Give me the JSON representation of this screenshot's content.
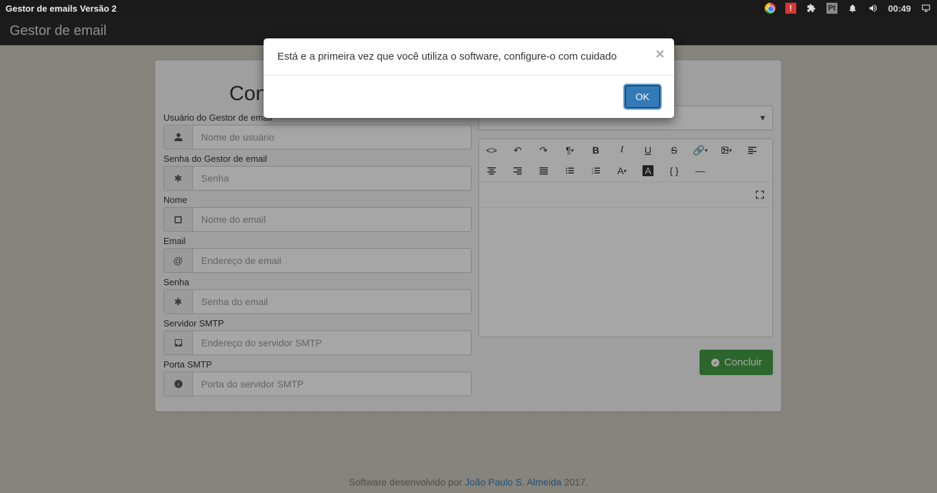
{
  "topbar": {
    "title": "Gestor de emails Versão 2",
    "lang_indicator": "Pt",
    "clock": "00:49"
  },
  "header": {
    "title": "Gestor de email"
  },
  "form": {
    "title": "Conf",
    "user_label": "Usuário do Gestor de email",
    "user_placeholder": "Nome de usuário",
    "pass_label": "Senha do Gestor de email",
    "pass_placeholder": "Senha",
    "name_label": "Nome",
    "name_placeholder": "Nome do email",
    "email_label": "Email",
    "email_placeholder": "Endereço de email",
    "emailpass_label": "Senha",
    "emailpass_placeholder": "Senha do email",
    "smtp_label": "Servidor SMTP",
    "smtp_placeholder": "Endereço do servidor SMTP",
    "port_label": "Porta SMTP",
    "port_placeholder": "Porta do servidor SMTP"
  },
  "editor": {
    "concluir": "Concluir"
  },
  "footer": {
    "pre": "Software desenvolvido por ",
    "link": "João Paulo S. Almeida",
    "post": " 2017."
  },
  "modal": {
    "message": "Está e a primeira vez que você utiliza o software, configure-o com cuidado",
    "ok": "OK"
  }
}
